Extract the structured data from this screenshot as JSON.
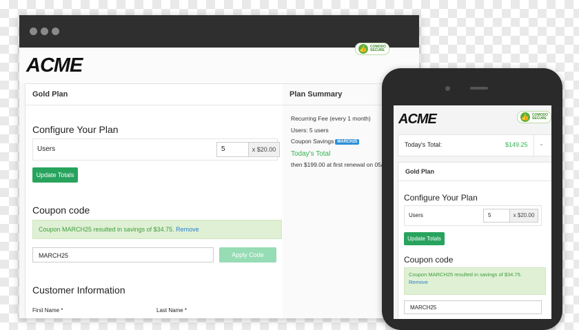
{
  "brand": {
    "logo": "ACME",
    "secure_badge": [
      "COMODO",
      "SECURE"
    ]
  },
  "desktop": {
    "plan_title": "Gold Plan",
    "configure_heading": "Configure Your Plan",
    "users_label": "Users",
    "users_value": "5",
    "users_price": "x $20.00",
    "update_button": "Update Totals",
    "coupon_heading": "Coupon code",
    "coupon_message": "Coupon MARCH25 resulted in savings of $34.75.",
    "coupon_remove": "Remove",
    "coupon_input_value": "MARCH25",
    "apply_button": "Apply Code",
    "customer_heading": "Customer Information",
    "first_name_label": "First Name *",
    "last_name_label": "Last Name *"
  },
  "summary": {
    "title": "Plan Summary",
    "recurring_fee": "Recurring Fee (every 1 month)",
    "users": "Users: 5 users",
    "coupon_savings": "Coupon Savings",
    "coupon_badge": "MARCH25",
    "todays_total": "Today's Total",
    "renewal": "then $199.00 at first renewal on 05/"
  },
  "mobile": {
    "todays_total_label": "Today's Total:",
    "todays_total_value": "$149.25",
    "expand_icon": "chevron-down-icon",
    "plan_title": "Gold Plan",
    "configure_heading": "Configure Your Plan",
    "users_label": "Users",
    "users_value": "5",
    "users_price": "x $20.00",
    "update_button": "Update Totals",
    "coupon_heading": "Coupon code",
    "coupon_message": "Coupon MARCH25 resulted in savings of $34.75.",
    "coupon_remove": "Remove",
    "coupon_input_value": "MARCH25"
  },
  "colors": {
    "primary_green": "#28a35e",
    "success_text": "#34b24e",
    "link_blue": "#2a7fd0",
    "badge_blue": "#2d8fd8"
  }
}
